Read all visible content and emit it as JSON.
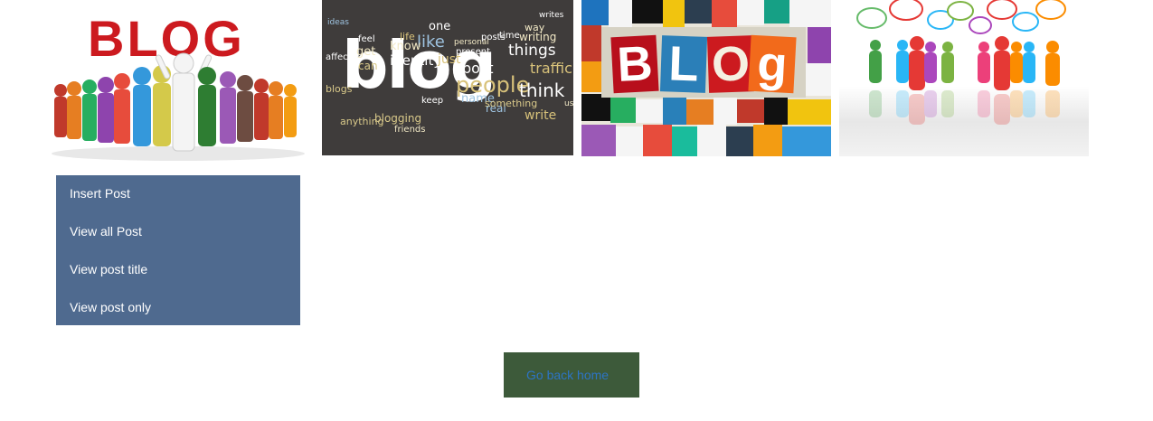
{
  "banners": {
    "banner1": {
      "title": "BLOG"
    },
    "banner2": {
      "main_word": "blog",
      "words": [
        "like",
        "know",
        "identity",
        "get",
        "can",
        "post",
        "people",
        "think",
        "things",
        "traffic",
        "writing",
        "just",
        "name",
        "real",
        "something",
        "write",
        "anything",
        "blogging",
        "friends",
        "keep",
        "present",
        "personal",
        "time",
        "one",
        "life",
        "feel",
        "affect",
        "use",
        "way",
        "posts",
        "ideas",
        "writes",
        "blogs"
      ]
    },
    "banner3": {
      "letters": [
        "B",
        "L",
        "O",
        "g"
      ]
    },
    "banner4": {}
  },
  "menu": {
    "items": [
      {
        "label": "Insert Post"
      },
      {
        "label": "View all Post"
      },
      {
        "label": "View post title"
      },
      {
        "label": "View post only"
      }
    ]
  },
  "home_button": {
    "label": "Go back home"
  },
  "colors": {
    "menu_bg": "#4f6a8f",
    "button_bg": "#3d5a3a",
    "button_text": "#2d74c4",
    "blog_red": "#cc1a1f"
  }
}
